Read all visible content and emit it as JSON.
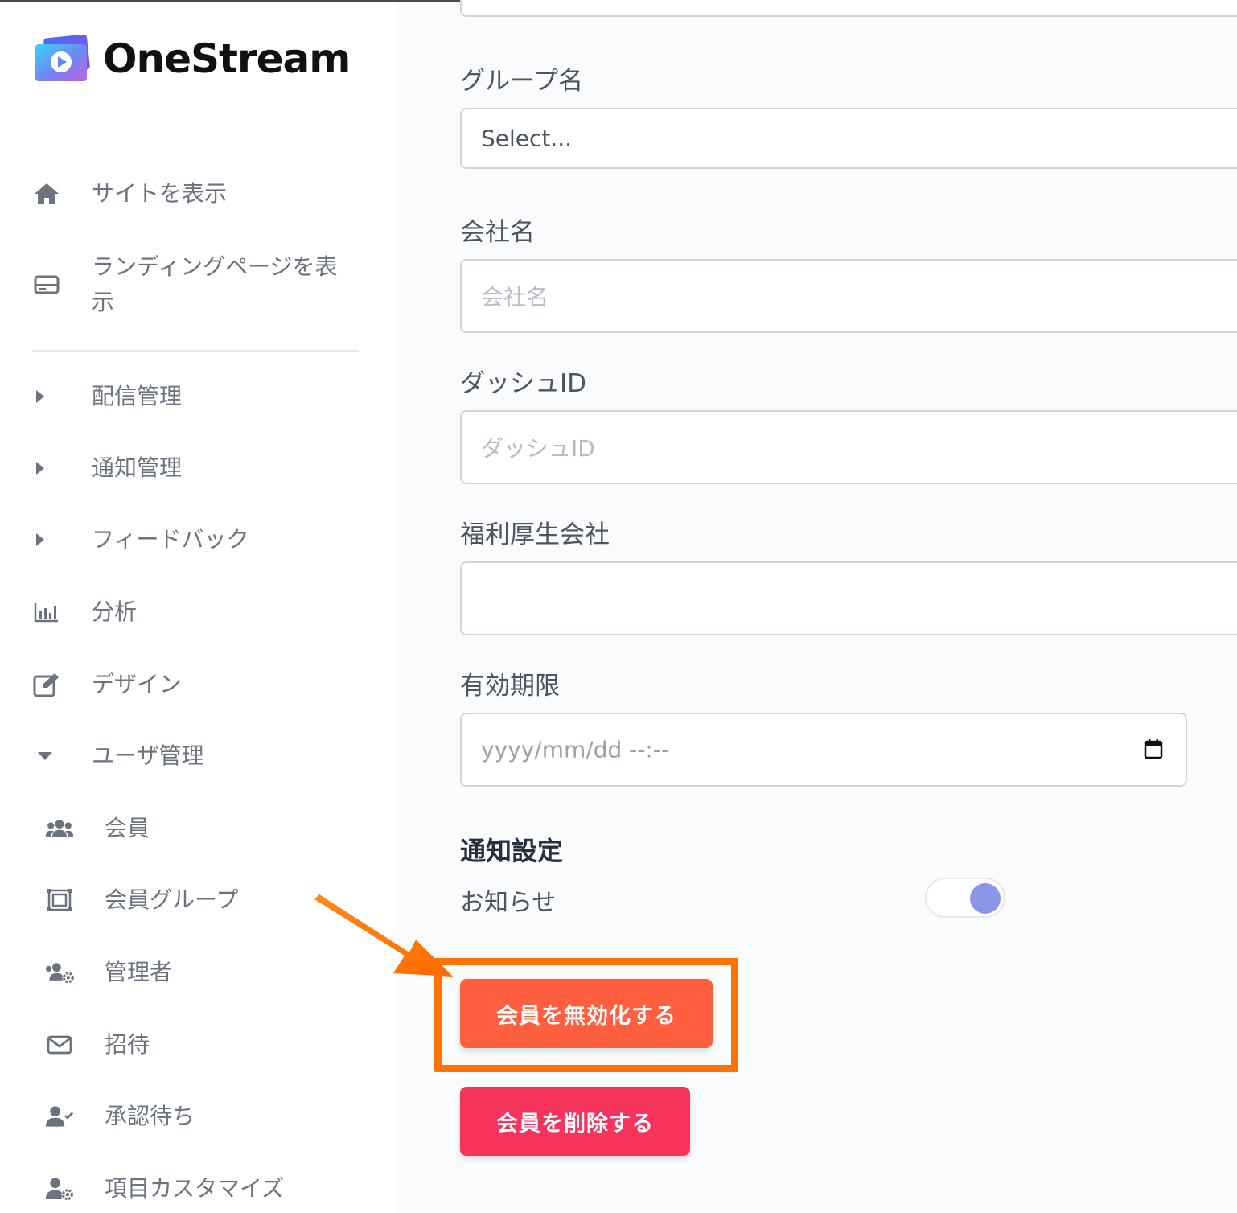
{
  "brand": {
    "name": "OneStream"
  },
  "sidebar": {
    "items": [
      {
        "label": "サイトを表示",
        "icon": "home-icon"
      },
      {
        "label": "ランディングページを表示",
        "line1": "ランディングページを表",
        "line2": "示",
        "icon": "landing-page-icon"
      },
      {
        "label": "配信管理",
        "icon": "caret-right-icon"
      },
      {
        "label": "通知管理",
        "icon": "caret-right-icon"
      },
      {
        "label": "フィードバック",
        "icon": "caret-right-icon"
      },
      {
        "label": "分析",
        "icon": "bar-chart-icon"
      },
      {
        "label": "デザイン",
        "icon": "edit-icon"
      },
      {
        "label": "ユーザ管理",
        "icon": "caret-down-icon"
      }
    ],
    "sub_items": [
      {
        "label": "会員",
        "icon": "users-icon"
      },
      {
        "label": "会員グループ",
        "icon": "group-frame-icon"
      },
      {
        "label": "管理者",
        "icon": "users-gear-icon"
      },
      {
        "label": "招待",
        "icon": "envelope-icon"
      },
      {
        "label": "承認待ち",
        "icon": "user-check-icon"
      },
      {
        "label": "項目カスタマイズ",
        "icon": "user-gear-icon"
      }
    ]
  },
  "form": {
    "group": {
      "label": "グループ名",
      "value": "Select..."
    },
    "company": {
      "label": "会社名",
      "placeholder": "会社名"
    },
    "dash_id": {
      "label": "ダッシュID",
      "placeholder": "ダッシュID"
    },
    "welfare": {
      "label": "福利厚生会社",
      "value": ""
    },
    "expiry": {
      "label": "有効期限",
      "placeholder": "yyyy/mm/dd  --:--",
      "icon": "calendar-icon"
    }
  },
  "notifications": {
    "title": "通知設定",
    "news_label": "お知らせ",
    "news_enabled": true
  },
  "actions": {
    "disable_label": "会員を無効化する",
    "delete_label": "会員を削除する"
  },
  "colors": {
    "disable_button": "#ff5f3f",
    "delete_button": "#f5335b",
    "highlight": "#ff7400",
    "toggle_knob": "#8a96e8"
  }
}
